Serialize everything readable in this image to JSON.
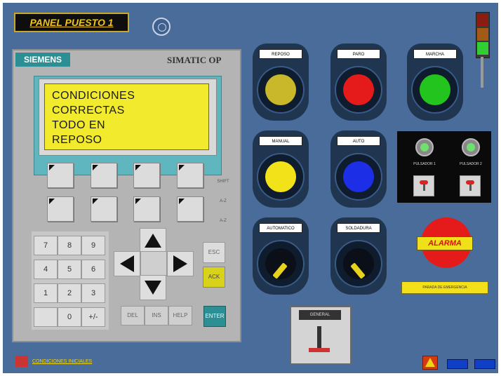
{
  "title": "PANEL PUESTO 1",
  "panel": {
    "brand": "SIEMENS",
    "model": "SIMATIC OP",
    "lcd_lines": [
      "CONDICIONES",
      "CORRECTAS",
      "TODO EN",
      "REPOSO"
    ],
    "keypad": [
      "7",
      "8",
      "9",
      "4",
      "5",
      "6",
      "1",
      "2",
      "3",
      "0",
      "+/-"
    ],
    "bottom_keys": [
      "DEL",
      "INS",
      "HELP",
      "ENTER"
    ],
    "side_keys": [
      "ESC",
      "ACK"
    ],
    "side_labels": [
      "SHIFT",
      "A-Z",
      "A-Z"
    ]
  },
  "buttons": [
    {
      "label": "REPOSO",
      "color": "#c9b92a"
    },
    {
      "label": "PARO",
      "color": "#e51a1a"
    },
    {
      "label": "MARCHA",
      "color": "#23c41d"
    },
    {
      "label": "MANUAL",
      "color": "#f2e21a"
    },
    {
      "label": "AUTO",
      "color": "#1c2ee6"
    }
  ],
  "selectors": [
    {
      "label": "AUTOMATICO"
    },
    {
      "label": "SOLDADURA"
    }
  ],
  "lamps": [
    {
      "label": "PULSADOR 1"
    },
    {
      "label": "PULSADOR 2"
    }
  ],
  "stacklight": [
    "#8a1c12",
    "#a35a17",
    "#33cc33"
  ],
  "alarm": {
    "label": "ALARMA"
  },
  "emergency": {
    "label": "PARADA DE EMERGENCIA"
  },
  "main_switch": {
    "label": "GENERAL"
  },
  "footer": {
    "link": "CONDICIONES INICIALES"
  }
}
